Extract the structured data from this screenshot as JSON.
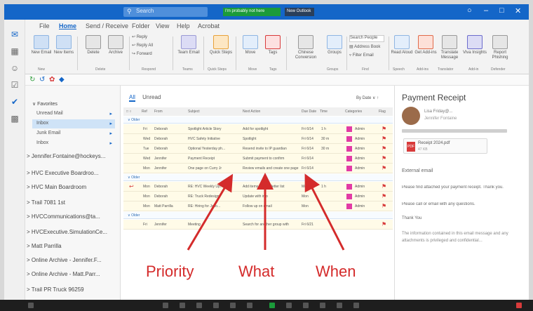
{
  "titlebar": {
    "search_placeholder": "Search",
    "badge_green": "I'm probably not here",
    "badge_dark": "New Outlook"
  },
  "ribbon": {
    "tabs": [
      "File",
      "Home",
      "Send / Receive",
      "Folder",
      "View",
      "Help",
      "Acrobat"
    ],
    "buttons": [
      {
        "label": "New Email",
        "icon": "new-email-icon"
      },
      {
        "label": "New Items",
        "icon": "new-items-icon"
      },
      {
        "label": "Delete",
        "icon": "delete-icon"
      },
      {
        "label": "Archive",
        "icon": "archive-icon"
      },
      {
        "label": "Reply",
        "icon": "reply-icon"
      },
      {
        "label": "Reply All",
        "icon": "reply-all-icon"
      },
      {
        "label": "Forward",
        "icon": "forward-icon"
      },
      {
        "label": "Team Email",
        "icon": "team-email-icon"
      },
      {
        "label": "Quick Steps",
        "icon": "quick-steps-icon"
      },
      {
        "label": "Move",
        "icon": "move-icon"
      },
      {
        "label": "Tags",
        "icon": "tags-icon"
      },
      {
        "label": "Chinese Conversion",
        "icon": "chinese-conversion-icon"
      },
      {
        "label": "Groups",
        "icon": "groups-icon"
      },
      {
        "label": "Search People",
        "icon": "search-people-icon"
      },
      {
        "label": "Address Book",
        "icon": "address-book-icon"
      },
      {
        "label": "Filter Email",
        "icon": "filter-email-icon"
      },
      {
        "label": "Read Aloud",
        "icon": "read-aloud-icon"
      },
      {
        "label": "Get Add-ins",
        "icon": "get-addins-icon"
      },
      {
        "label": "Translate Message",
        "icon": "translate-icon"
      },
      {
        "label": "Viva Insights",
        "icon": "viva-insights-icon"
      },
      {
        "label": "Report Phishing",
        "icon": "report-phishing-icon"
      }
    ],
    "groups": [
      "New",
      "Delete",
      "Respond",
      "Teams",
      "Quick Steps",
      "Move",
      "Tags",
      "Groups",
      "Find",
      "Speech",
      "Add-ins",
      "Translator",
      "Add-in",
      "Defender"
    ]
  },
  "folders": {
    "favorites_label": "Favorites",
    "favorites": [
      {
        "name": "Unread Mail",
        "count": ""
      },
      {
        "name": "Inbox",
        "count": ""
      },
      {
        "name": "Junk Email",
        "count": ""
      },
      {
        "name": "Inbox",
        "count": ""
      }
    ],
    "accounts": [
      "Jennifer.Fontaine@hockeys...",
      "HVC Executive Boardroo...",
      "HVC Main Boardroom",
      "Trail 7081 1st",
      "HVCCommunications@ta...",
      "HVCExecutive.SimulationCe...",
      "Matt Parrilla",
      "Online Archive - Jennifer.F...",
      "Online Archive - Matt.Parr...",
      "Trail PR Truck 96259"
    ]
  },
  "list": {
    "tabs": [
      "All",
      "Unread"
    ],
    "sort_label": "By Date",
    "columns": [
      "Ref",
      "From",
      "Subject",
      "Next Action",
      "Due Date",
      "Time",
      "Categories",
      "Flag"
    ],
    "groups": [
      "Older",
      "Older",
      "Older"
    ],
    "rows": [
      {
        "from": "Deborah",
        "subject": "Spotlight Article Story",
        "action": "Add for spotlight",
        "due": "Fri 6/14",
        "time": "1 h",
        "cat": "Admin"
      },
      {
        "from": "Deborah",
        "subject": "HVC Safety Initiative",
        "action": "Spotlight",
        "due": "Fri 6/14",
        "time": "30 m",
        "cat": "Admin"
      },
      {
        "from": "Deborah",
        "subject": "Optional Yesterday ph...",
        "action": "Resend invite to IP guardian",
        "due": "Fri 6/14",
        "time": "30 m",
        "cat": "Admin"
      },
      {
        "from": "Jennifer",
        "subject": "Payment Receipt",
        "action": "Submit payment to confirm",
        "due": "Fri 6/14",
        "time": "",
        "cat": "Admin"
      },
      {
        "from": "Jennifer",
        "subject": "One page on Curry Jr",
        "action": "Review emails and create one page",
        "due": "Fri 6/14",
        "time": "",
        "cat": "Admin"
      },
      {
        "from": "Deborah",
        "subject": "RE: HVC Weekly Up...",
        "action": "Add items to newsletter list",
        "due": "Mon",
        "time": "1 h",
        "cat": "Admin"
      },
      {
        "from": "Deborah",
        "subject": "RE: Truck Redesign",
        "action": "Update with info",
        "due": "Mon",
        "time": "",
        "cat": "Admin"
      },
      {
        "from": "Matt Parrilla",
        "subject": "RE: Hiring for Jaco...",
        "action": "Follow up on email",
        "due": "Mon",
        "time": "",
        "cat": "Admin"
      },
      {
        "from": "Jennifer",
        "subject": "Meeting",
        "action": "Search for another group with",
        "due": "Fri 6/21",
        "time": "",
        "cat": ""
      }
    ]
  },
  "reading": {
    "title": "Payment Receipt",
    "sender": "Lisa Friday@...",
    "to": "Jennifer Fontaine",
    "attachment": "Receipt 2024.pdf",
    "attachment_size": "47 KB",
    "body": [
      "External email",
      "Please find attached your payment receipt. Thank you.",
      "Please call or email with any questions.",
      "Thank You",
      "The information contained in this email message and any attachments is privileged and confidential..."
    ]
  },
  "annotations": [
    "Priority",
    "What",
    "When"
  ],
  "colors": {
    "accent": "#1466c8",
    "annotation": "#d42b2b",
    "category": "#e23aa5",
    "row_highlight": "#fffbe8"
  }
}
